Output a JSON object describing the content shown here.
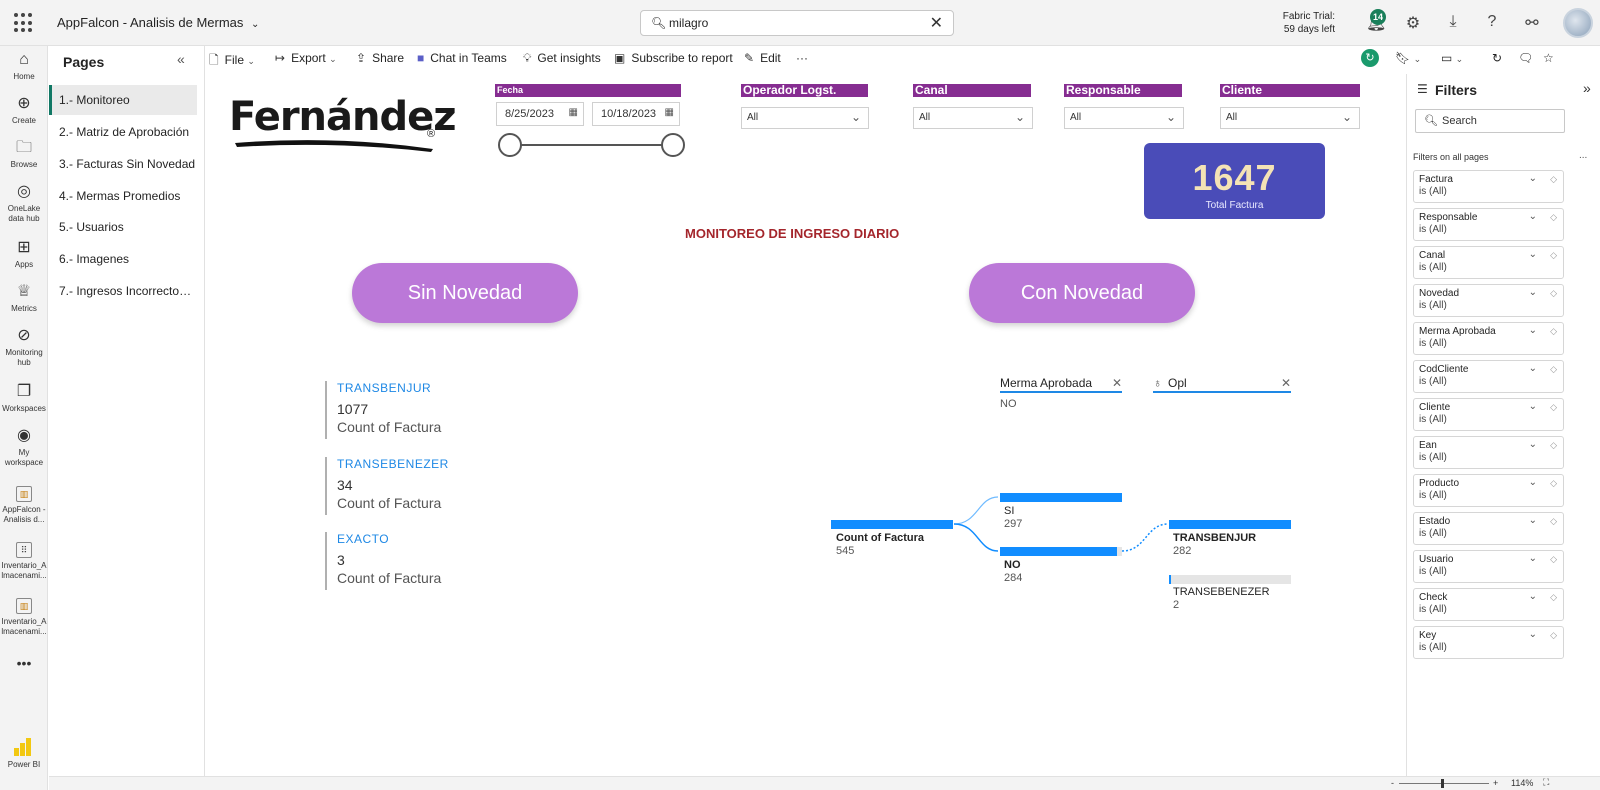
{
  "topbar": {
    "app_title": "AppFalcon - Analisis de Mermas",
    "search_value": "milagro",
    "trial_line1": "Fabric Trial:",
    "trial_line2": "59 days left",
    "notification_count": "14"
  },
  "leftnav": [
    {
      "label": "Home",
      "icon": "home-icon"
    },
    {
      "label": "Create",
      "icon": "plus-circle-icon"
    },
    {
      "label": "Browse",
      "icon": "folder-icon"
    },
    {
      "label": "OneLake data hub",
      "icon": "onelake-icon"
    },
    {
      "label": "Apps",
      "icon": "apps-icon"
    },
    {
      "label": "Metrics",
      "icon": "trophy-icon"
    },
    {
      "label": "Monitoring hub",
      "icon": "monitor-icon"
    },
    {
      "label": "Workspaces",
      "icon": "workspaces-icon"
    },
    {
      "label": "My workspace",
      "icon": "globe-icon"
    },
    {
      "label": "AppFalcon - Analisis d...",
      "icon": "report-icon"
    },
    {
      "label": "Inventario_A lmacenami...",
      "icon": "dashboard-icon"
    },
    {
      "label": "Inventario_A lmacenami...",
      "icon": "report-icon"
    }
  ],
  "leftnav_brand": "Power BI",
  "pages": {
    "title": "Pages",
    "items": [
      "1.- Monitoreo",
      "2.- Matriz de Aprobación",
      "3.- Facturas Sin Novedad",
      "4.- Mermas Promedios",
      "5.- Usuarios",
      "6.- Imagenes",
      "7.- Ingresos Incorrectos ..."
    ]
  },
  "actionbar": {
    "file": "File",
    "export": "Export",
    "share": "Share",
    "chat": "Chat in Teams",
    "insights": "Get insights",
    "subscribe": "Subscribe to report",
    "edit": "Edit"
  },
  "report": {
    "logo_text": "Fernández",
    "logo_reg": "®",
    "fecha": {
      "label": "Fecha",
      "start": "8/25/2023",
      "end": "10/18/2023"
    },
    "slicers": [
      {
        "label": "Operador Logst.",
        "value": "All"
      },
      {
        "label": "Canal",
        "value": "All"
      },
      {
        "label": "Responsable",
        "value": "All"
      },
      {
        "label": "Cliente",
        "value": "All"
      }
    ],
    "kpi": {
      "value": "1647",
      "label": "Total Factura"
    },
    "title": "MONITOREO DE INGRESO DIARIO",
    "pill_left": "Sin Novedad",
    "pill_right": "Con Novedad",
    "cards": [
      {
        "name": "TRANSBENJUR",
        "value": "1077",
        "label": "Count of Factura"
      },
      {
        "name": "TRANSEBENEZER",
        "value": "34",
        "label": "Count of Factura"
      },
      {
        "name": "EXACTO",
        "value": "3",
        "label": "Count of Factura"
      }
    ],
    "tree": {
      "level1_header": "Merma Aprobada",
      "level1_selected": "NO",
      "level2_header": "Opl",
      "root": {
        "label": "Count of Factura",
        "value": "545"
      },
      "nodes": [
        {
          "label": "SI",
          "value": "297"
        },
        {
          "label": "NO",
          "value": "284"
        }
      ],
      "leaves": [
        {
          "label": "TRANSBENJUR",
          "value": "282"
        },
        {
          "label": "TRANSEBENEZER",
          "value": "2"
        }
      ]
    }
  },
  "filters": {
    "title": "Filters",
    "search_placeholder": "Search",
    "subtitle": "Filters on all pages",
    "items": [
      {
        "name": "Factura",
        "state": "is (All)"
      },
      {
        "name": "Responsable",
        "state": "is (All)"
      },
      {
        "name": "Canal",
        "state": "is (All)"
      },
      {
        "name": "Novedad",
        "state": "is (All)"
      },
      {
        "name": "Merma Aprobada",
        "state": "is (All)"
      },
      {
        "name": "CodCliente",
        "state": "is (All)"
      },
      {
        "name": "Cliente",
        "state": "is (All)"
      },
      {
        "name": "Ean",
        "state": "is (All)"
      },
      {
        "name": "Producto",
        "state": "is (All)"
      },
      {
        "name": "Estado",
        "state": "is (All)"
      },
      {
        "name": "Usuario",
        "state": "is (All)"
      },
      {
        "name": "Check",
        "state": "is (All)"
      },
      {
        "name": "Key",
        "state": "is (All)"
      }
    ]
  },
  "statusbar": {
    "zoom": "114%",
    "minus": "-",
    "plus": "+"
  },
  "colors": {
    "slicer_header": "#862d91",
    "kpi_bg": "#4a4cb8",
    "pill": "#bb78d8",
    "title_red": "#a4262c",
    "accent_blue": "#118dff",
    "active_page": "#117865"
  }
}
